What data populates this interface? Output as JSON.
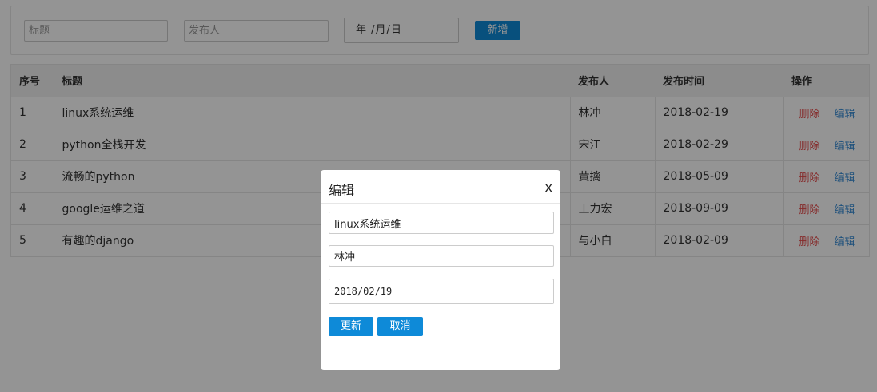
{
  "toolbar": {
    "title_placeholder": "标题",
    "author_placeholder": "发布人",
    "date_placeholder": "年 /月/日",
    "add_label": "新增"
  },
  "table": {
    "headers": [
      "序号",
      "标题",
      "发布人",
      "发布时间",
      "操作"
    ],
    "rows": [
      {
        "id": "1",
        "title": "linux系统运维",
        "author": "林冲",
        "date": "2018-02-19"
      },
      {
        "id": "2",
        "title": "python全栈开发",
        "author": "宋江",
        "date": "2018-02-29"
      },
      {
        "id": "3",
        "title": "流畅的python",
        "author": "黄擒",
        "date": "2018-05-09"
      },
      {
        "id": "4",
        "title": "google运维之道",
        "author": "王力宏",
        "date": "2018-09-09"
      },
      {
        "id": "5",
        "title": "有趣的django",
        "author": "与小白",
        "date": "2018-02-09"
      }
    ],
    "delete_label": "删除",
    "edit_label": "编辑"
  },
  "modal": {
    "title": "编辑",
    "close": "x",
    "title_value": "linux系统运维",
    "author_value": "林冲",
    "date_value": "2018/02/19",
    "update_label": "更新",
    "cancel_label": "取消"
  },
  "colors": {
    "accent": "#0e8ad8",
    "delete": "#e64a4a",
    "edit": "#3a8ed6"
  }
}
